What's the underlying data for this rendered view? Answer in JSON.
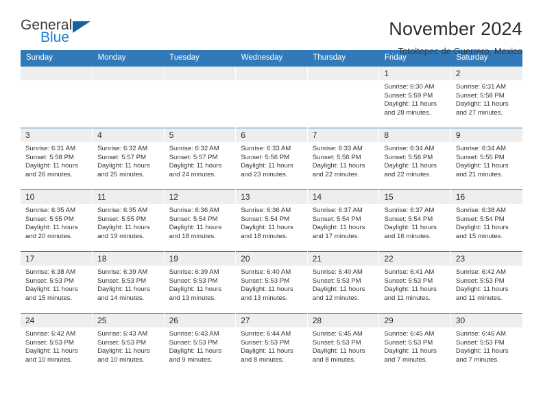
{
  "brand": {
    "name_part1": "General",
    "name_part2": "Blue",
    "triangle_color": "#13619f",
    "blue_color": "#1c7fd4"
  },
  "header": {
    "title": "November 2024",
    "subtitle": "Totoltepec de Guerrero, Mexico"
  },
  "theme": {
    "header_bar_color": "#3179b8",
    "daynum_bg": "#eeeeee",
    "text_color": "#333333"
  },
  "weekdays": [
    "Sunday",
    "Monday",
    "Tuesday",
    "Wednesday",
    "Thursday",
    "Friday",
    "Saturday"
  ],
  "weeks": [
    [
      {
        "day": "",
        "sunrise": "",
        "sunset": "",
        "daylight_line1": "",
        "daylight_line2": "",
        "empty": true
      },
      {
        "day": "",
        "sunrise": "",
        "sunset": "",
        "daylight_line1": "",
        "daylight_line2": "",
        "empty": true
      },
      {
        "day": "",
        "sunrise": "",
        "sunset": "",
        "daylight_line1": "",
        "daylight_line2": "",
        "empty": true
      },
      {
        "day": "",
        "sunrise": "",
        "sunset": "",
        "daylight_line1": "",
        "daylight_line2": "",
        "empty": true
      },
      {
        "day": "",
        "sunrise": "",
        "sunset": "",
        "daylight_line1": "",
        "daylight_line2": "",
        "empty": true
      },
      {
        "day": "1",
        "sunrise": "Sunrise: 6:30 AM",
        "sunset": "Sunset: 5:59 PM",
        "daylight_line1": "Daylight: 11 hours",
        "daylight_line2": "and 28 minutes."
      },
      {
        "day": "2",
        "sunrise": "Sunrise: 6:31 AM",
        "sunset": "Sunset: 5:58 PM",
        "daylight_line1": "Daylight: 11 hours",
        "daylight_line2": "and 27 minutes."
      }
    ],
    [
      {
        "day": "3",
        "sunrise": "Sunrise: 6:31 AM",
        "sunset": "Sunset: 5:58 PM",
        "daylight_line1": "Daylight: 11 hours",
        "daylight_line2": "and 26 minutes."
      },
      {
        "day": "4",
        "sunrise": "Sunrise: 6:32 AM",
        "sunset": "Sunset: 5:57 PM",
        "daylight_line1": "Daylight: 11 hours",
        "daylight_line2": "and 25 minutes."
      },
      {
        "day": "5",
        "sunrise": "Sunrise: 6:32 AM",
        "sunset": "Sunset: 5:57 PM",
        "daylight_line1": "Daylight: 11 hours",
        "daylight_line2": "and 24 minutes."
      },
      {
        "day": "6",
        "sunrise": "Sunrise: 6:33 AM",
        "sunset": "Sunset: 5:56 PM",
        "daylight_line1": "Daylight: 11 hours",
        "daylight_line2": "and 23 minutes."
      },
      {
        "day": "7",
        "sunrise": "Sunrise: 6:33 AM",
        "sunset": "Sunset: 5:56 PM",
        "daylight_line1": "Daylight: 11 hours",
        "daylight_line2": "and 22 minutes."
      },
      {
        "day": "8",
        "sunrise": "Sunrise: 6:34 AM",
        "sunset": "Sunset: 5:56 PM",
        "daylight_line1": "Daylight: 11 hours",
        "daylight_line2": "and 22 minutes."
      },
      {
        "day": "9",
        "sunrise": "Sunrise: 6:34 AM",
        "sunset": "Sunset: 5:55 PM",
        "daylight_line1": "Daylight: 11 hours",
        "daylight_line2": "and 21 minutes."
      }
    ],
    [
      {
        "day": "10",
        "sunrise": "Sunrise: 6:35 AM",
        "sunset": "Sunset: 5:55 PM",
        "daylight_line1": "Daylight: 11 hours",
        "daylight_line2": "and 20 minutes."
      },
      {
        "day": "11",
        "sunrise": "Sunrise: 6:35 AM",
        "sunset": "Sunset: 5:55 PM",
        "daylight_line1": "Daylight: 11 hours",
        "daylight_line2": "and 19 minutes."
      },
      {
        "day": "12",
        "sunrise": "Sunrise: 6:36 AM",
        "sunset": "Sunset: 5:54 PM",
        "daylight_line1": "Daylight: 11 hours",
        "daylight_line2": "and 18 minutes."
      },
      {
        "day": "13",
        "sunrise": "Sunrise: 6:36 AM",
        "sunset": "Sunset: 5:54 PM",
        "daylight_line1": "Daylight: 11 hours",
        "daylight_line2": "and 18 minutes."
      },
      {
        "day": "14",
        "sunrise": "Sunrise: 6:37 AM",
        "sunset": "Sunset: 5:54 PM",
        "daylight_line1": "Daylight: 11 hours",
        "daylight_line2": "and 17 minutes."
      },
      {
        "day": "15",
        "sunrise": "Sunrise: 6:37 AM",
        "sunset": "Sunset: 5:54 PM",
        "daylight_line1": "Daylight: 11 hours",
        "daylight_line2": "and 16 minutes."
      },
      {
        "day": "16",
        "sunrise": "Sunrise: 6:38 AM",
        "sunset": "Sunset: 5:54 PM",
        "daylight_line1": "Daylight: 11 hours",
        "daylight_line2": "and 15 minutes."
      }
    ],
    [
      {
        "day": "17",
        "sunrise": "Sunrise: 6:38 AM",
        "sunset": "Sunset: 5:53 PM",
        "daylight_line1": "Daylight: 11 hours",
        "daylight_line2": "and 15 minutes."
      },
      {
        "day": "18",
        "sunrise": "Sunrise: 6:39 AM",
        "sunset": "Sunset: 5:53 PM",
        "daylight_line1": "Daylight: 11 hours",
        "daylight_line2": "and 14 minutes."
      },
      {
        "day": "19",
        "sunrise": "Sunrise: 6:39 AM",
        "sunset": "Sunset: 5:53 PM",
        "daylight_line1": "Daylight: 11 hours",
        "daylight_line2": "and 13 minutes."
      },
      {
        "day": "20",
        "sunrise": "Sunrise: 6:40 AM",
        "sunset": "Sunset: 5:53 PM",
        "daylight_line1": "Daylight: 11 hours",
        "daylight_line2": "and 13 minutes."
      },
      {
        "day": "21",
        "sunrise": "Sunrise: 6:40 AM",
        "sunset": "Sunset: 5:53 PM",
        "daylight_line1": "Daylight: 11 hours",
        "daylight_line2": "and 12 minutes."
      },
      {
        "day": "22",
        "sunrise": "Sunrise: 6:41 AM",
        "sunset": "Sunset: 5:53 PM",
        "daylight_line1": "Daylight: 11 hours",
        "daylight_line2": "and 11 minutes."
      },
      {
        "day": "23",
        "sunrise": "Sunrise: 6:42 AM",
        "sunset": "Sunset: 5:53 PM",
        "daylight_line1": "Daylight: 11 hours",
        "daylight_line2": "and 11 minutes."
      }
    ],
    [
      {
        "day": "24",
        "sunrise": "Sunrise: 6:42 AM",
        "sunset": "Sunset: 5:53 PM",
        "daylight_line1": "Daylight: 11 hours",
        "daylight_line2": "and 10 minutes."
      },
      {
        "day": "25",
        "sunrise": "Sunrise: 6:43 AM",
        "sunset": "Sunset: 5:53 PM",
        "daylight_line1": "Daylight: 11 hours",
        "daylight_line2": "and 10 minutes."
      },
      {
        "day": "26",
        "sunrise": "Sunrise: 6:43 AM",
        "sunset": "Sunset: 5:53 PM",
        "daylight_line1": "Daylight: 11 hours",
        "daylight_line2": "and 9 minutes."
      },
      {
        "day": "27",
        "sunrise": "Sunrise: 6:44 AM",
        "sunset": "Sunset: 5:53 PM",
        "daylight_line1": "Daylight: 11 hours",
        "daylight_line2": "and 8 minutes."
      },
      {
        "day": "28",
        "sunrise": "Sunrise: 6:45 AM",
        "sunset": "Sunset: 5:53 PM",
        "daylight_line1": "Daylight: 11 hours",
        "daylight_line2": "and 8 minutes."
      },
      {
        "day": "29",
        "sunrise": "Sunrise: 6:45 AM",
        "sunset": "Sunset: 5:53 PM",
        "daylight_line1": "Daylight: 11 hours",
        "daylight_line2": "and 7 minutes."
      },
      {
        "day": "30",
        "sunrise": "Sunrise: 6:46 AM",
        "sunset": "Sunset: 5:53 PM",
        "daylight_line1": "Daylight: 11 hours",
        "daylight_line2": "and 7 minutes."
      }
    ]
  ]
}
